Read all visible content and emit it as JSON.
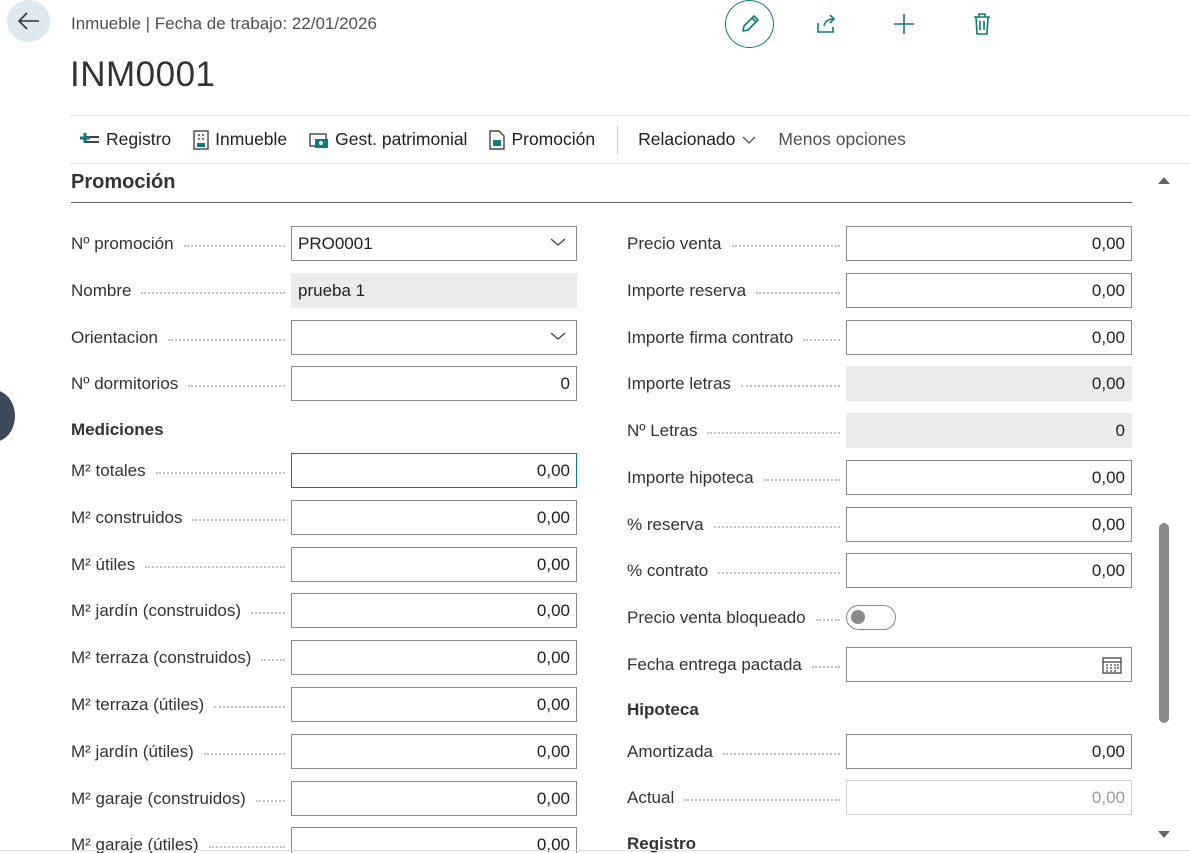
{
  "header": {
    "breadcrumb": "Inmueble | Fecha de trabajo: 22/01/2026",
    "title": "INM0001"
  },
  "toolbar": {
    "actions": [
      {
        "label": "Registro",
        "icon": "add-register-icon"
      },
      {
        "label": "Inmueble",
        "icon": "building-doc-icon"
      },
      {
        "label": "Gest. patrimonial",
        "icon": "asset-management-icon"
      },
      {
        "label": "Promoción",
        "icon": "document-icon"
      }
    ],
    "related_label": "Relacionado",
    "less_options_label": "Menos opciones"
  },
  "section": {
    "title": "Promoción",
    "left": {
      "promo_no": {
        "label": "Nº promoción",
        "value": "PRO0001"
      },
      "name": {
        "label": "Nombre",
        "value": "prueba 1"
      },
      "orientation": {
        "label": "Orientacion",
        "value": ""
      },
      "bedrooms": {
        "label": "Nº dormitorios",
        "value": "0"
      },
      "measurements_heading": "Mediciones",
      "measurements": [
        {
          "label": "M² totales",
          "value": "0,00"
        },
        {
          "label": "M² construidos",
          "value": "0,00"
        },
        {
          "label": "M² útiles",
          "value": "0,00"
        },
        {
          "label": "M² jardín (construidos)",
          "value": "0,00"
        },
        {
          "label": "M² terraza (construidos)",
          "value": "0,00"
        },
        {
          "label": "M² terraza (útiles)",
          "value": "0,00"
        },
        {
          "label": "M² jardín (útiles)",
          "value": "0,00"
        },
        {
          "label": "M² garaje (construidos)",
          "value": "0,00"
        },
        {
          "label": "M² garaje (útiles)",
          "value": "0,00"
        }
      ]
    },
    "right": {
      "sale_price": {
        "label": "Precio venta",
        "value": "0,00"
      },
      "reservation_amount": {
        "label": "Importe reserva",
        "value": "0,00"
      },
      "contract_amount": {
        "label": "Importe firma contrato",
        "value": "0,00"
      },
      "bills_amount": {
        "label": "Importe letras",
        "value": "0,00"
      },
      "bills_count": {
        "label": "Nº Letras",
        "value": "0"
      },
      "mortgage_amount": {
        "label": "Importe hipoteca",
        "value": "0,00"
      },
      "reservation_pct": {
        "label": "% reserva",
        "value": "0,00"
      },
      "contract_pct": {
        "label": "% contrato",
        "value": "0,00"
      },
      "price_locked": {
        "label": "Precio venta bloqueado",
        "value": false
      },
      "delivery_date": {
        "label": "Fecha entrega pactada",
        "value": ""
      },
      "mortgage_heading": "Hipoteca",
      "amortized": {
        "label": "Amortizada",
        "value": "0,00"
      },
      "current": {
        "label": "Actual",
        "value": "0,00"
      },
      "register_heading": "Registro"
    }
  },
  "colors": {
    "accent": "#0f7b7b",
    "back_button_bg": "#dde9ef",
    "readonly_bg": "#ebebeb"
  }
}
